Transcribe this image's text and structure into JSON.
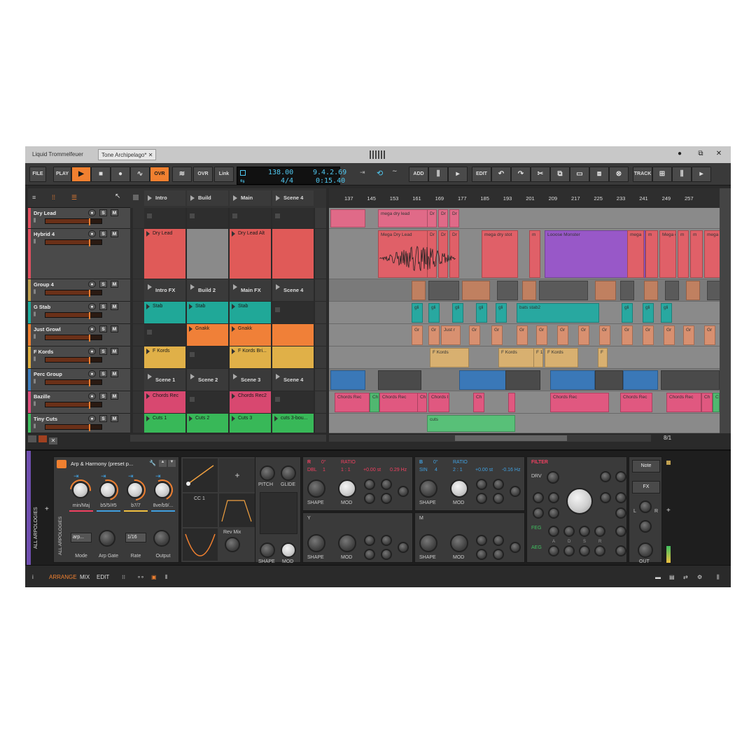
{
  "window": {
    "tabs": [
      "Liquid Trommelfeuer",
      "Tone Archipelago*"
    ]
  },
  "toolbar": {
    "file": "FILE",
    "play": "PLAY",
    "ovr": "OVR",
    "ovr2": "OVR",
    "link": "Link",
    "add": "ADD",
    "edit": "EDIT",
    "track": "TRACK"
  },
  "transport": {
    "tempo": "138.00",
    "signature": "4/4",
    "position": "9.4.2.69",
    "time": "0:15.40"
  },
  "scenes": {
    "header": [
      "Intro",
      "Build",
      "Main",
      "Scene 4"
    ]
  },
  "tracks": [
    {
      "name": "Dry Lead",
      "color": "#e05060"
    },
    {
      "name": "Hybrid 4",
      "color": "#e05060"
    },
    {
      "name": "Group 4",
      "color": "#c0a050"
    },
    {
      "name": "G Stab",
      "color": "#20b0a0"
    },
    {
      "name": "Just Growl",
      "color": "#f08030"
    },
    {
      "name": "F Kords",
      "color": "#e0b040"
    },
    {
      "name": "Perc Group",
      "color": "#4080c0"
    },
    {
      "name": "Bazille",
      "color": "#e05080"
    },
    {
      "name": "Tiny Cuts",
      "color": "#40c060"
    }
  ],
  "btn": {
    "s": "S",
    "m": "M"
  },
  "clips": {
    "r1": [
      "Dry Lead",
      "Dry Lead Alt"
    ],
    "r3": [
      "Intro FX",
      "Build 2",
      "Main FX",
      "Scene 4"
    ],
    "r4": [
      "Stab",
      "Stab",
      "Stab"
    ],
    "r5": [
      "Gnakk",
      "Gnakk"
    ],
    "r6": [
      "F Kords",
      "F Kords Bri..."
    ],
    "r7": [
      "Scene 1",
      "Scene 2",
      "Scene 3",
      "Scene 4"
    ],
    "r8": [
      "Chords Rec",
      "Chords Rec2"
    ],
    "r9": [
      "Cuts 1",
      "Cuts 2",
      "Cuts 3",
      "cuts 3-bou..."
    ]
  },
  "ruler": [
    "137",
    "145",
    "153",
    "161",
    "169",
    "177",
    "185",
    "193",
    "201",
    "209",
    "217",
    "225",
    "233",
    "241",
    "249",
    "257"
  ],
  "arrclips": {
    "mdl": "mega dry lead",
    "mDL": "Mega Dry Lead",
    "dr": "Dr",
    "mds": "mega dry stot",
    "m": "m",
    "lm": "Looose Monster",
    "mega": "mega",
    "megadr": "Mega dr",
    "gli": "gli",
    "bs2": "bats stab2",
    "gr": "Gr",
    "justr": "Just r",
    "fk": "F Kords",
    "f1": "F 1",
    "F": "F",
    "ch": "Ch",
    "chR": "Chords Rec",
    "chI": "Chords I",
    "cuts": "cuts"
  },
  "zoom": "8/1",
  "device": {
    "side": "ALL ARPOLOGIES",
    "side2": "ALL ARPOLOGIES",
    "preset": "Arp & Harmony (preset p...",
    "k1": [
      "min/Maj",
      "b5/5/#5",
      "b7/7",
      "8ve/b9/..."
    ],
    "k2": [
      "Mode",
      "Arp Gate",
      "Rate",
      "Output"
    ],
    "mode_val": "arp...",
    "rate_val": "1/16",
    "cc": "CC 1",
    "rev": "Rev Mix",
    "pitch": "PITCH",
    "glide": "GLIDE",
    "shape": "SHAPE",
    "mod": "MOD",
    "oscR": {
      "h": "R",
      "deg": "0°",
      "ratio": "RATIO",
      "dbl": "DBL",
      "n": "1",
      "r": "1 : 1",
      "st": "+0.00 st",
      "hz": "0.29 Hz"
    },
    "oscB": {
      "h": "B",
      "deg": "0°",
      "ratio": "RATIO",
      "sin": "SIN",
      "n": "4",
      "r": "2 : 1",
      "st": "+0.00 st",
      "hz": "-0.16 Hz"
    },
    "y": "Y",
    "mm": "M",
    "filter": "FILTER",
    "drv": "DRV",
    "feg": "FEG",
    "aeg": "AEG",
    "adsr": [
      "A",
      "D",
      "S",
      "R"
    ],
    "note": "Note",
    "fx": "FX",
    "l": "L",
    "r": "R",
    "out": "OUT"
  },
  "status": {
    "arrange": "ARRANGE",
    "mix": "MIX",
    "edit": "EDIT"
  }
}
